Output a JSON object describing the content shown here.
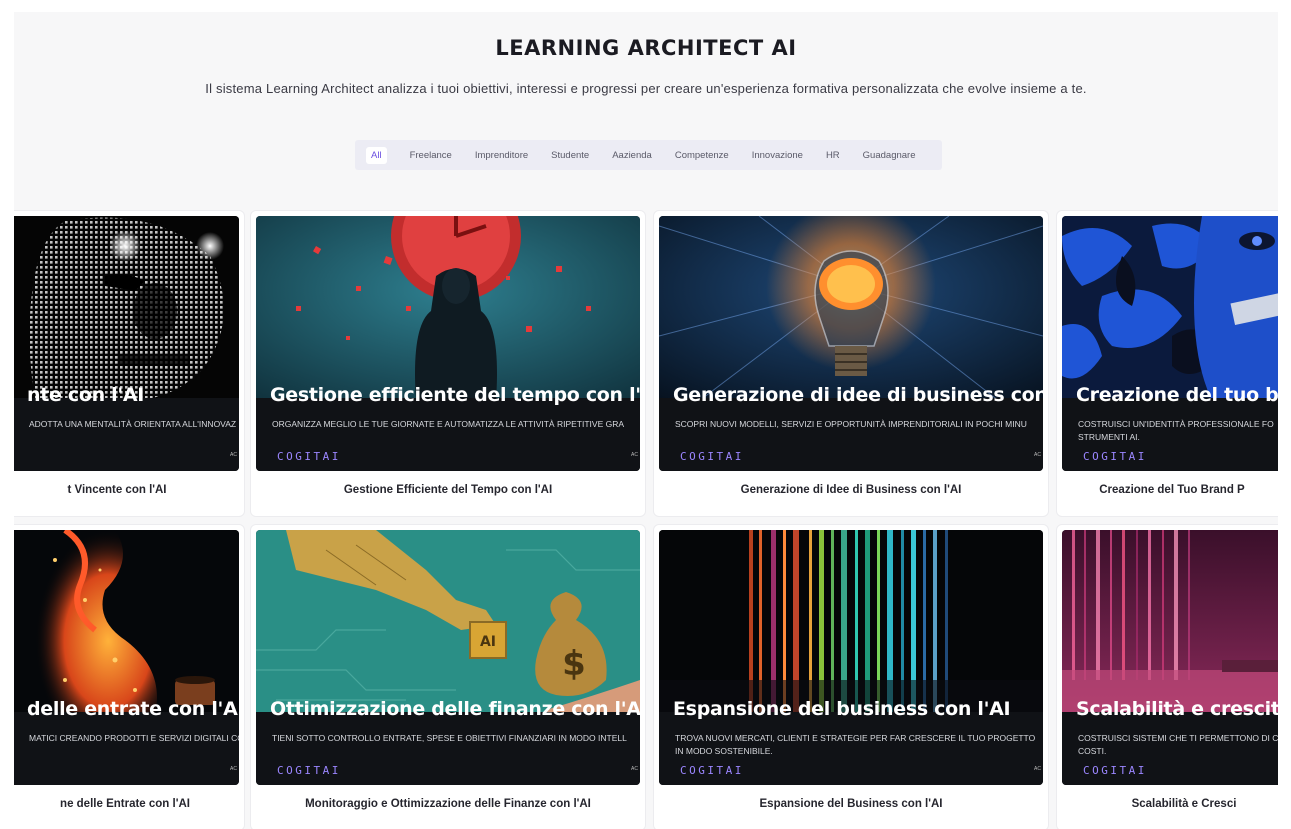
{
  "header": {
    "title": "LEARNING ARCHITECT AI",
    "subtitle": "Il sistema Learning Architect analizza i tuoi obiettivi, interessi e progressi per creare un'esperienza formativa personalizzata che evolve insieme a te."
  },
  "filters": {
    "active": "All",
    "items": [
      "All",
      "Freelance",
      "Imprenditore",
      "Studente",
      "Aazienda",
      "Competenze",
      "Innovazione",
      "HR",
      "Guadagnare"
    ]
  },
  "brand": {
    "logo_text": "COGITAI",
    "corner_text": "AC",
    "accent_color": "#9b86ff"
  },
  "cards": [
    {
      "headline": "nte con l'AI",
      "description": "ADOTTA UNA MENTALITÀ ORIENTATA ALL'INNOVAZ",
      "caption": "t Vincente con l'AI",
      "image": "digital-face"
    },
    {
      "headline": "Gestione efficiente del tempo con l'A",
      "description": "ORGANIZZA MEGLIO LE TUE GIORNATE E AUTOMATIZZA LE ATTIVITÀ RIPETITIVE GRA",
      "caption": "Gestione Efficiente del Tempo con l'AI",
      "image": "hooded-figure-clock"
    },
    {
      "headline": "Generazione di idee di business con l",
      "description": "SCOPRI NUOVI MODELLI, SERVIZI E OPPORTUNITÀ IMPRENDITORIALI IN POCHI MINU",
      "caption": "Generazione di Idee di Business con l'AI",
      "image": "brain-lightbulb"
    },
    {
      "headline": "Creazione del tuo br",
      "description": "COSTRUISCI UN'IDENTITÀ PROFESSIONALE FO STRUMENTI AI.",
      "caption": "Creazione del Tuo Brand P",
      "image": "blue-face"
    },
    {
      "headline": "delle entrate con l'AI",
      "description": "MATICI CREANDO PRODOTTI E SERVIZI DIGITALI CO",
      "caption": "ne delle Entrate con l'AI",
      "image": "fire-figure"
    },
    {
      "headline": "Ottimizzazione delle finanze con l'AI",
      "description": "TIENI SOTTO CONTROLLO ENTRATE, SPESE E OBIETTIVI FINANZIARI IN MODO INTELL",
      "caption": "Monitoraggio e Ottimizzazione delle Finanze con l'AI",
      "image": "robot-hand-money"
    },
    {
      "headline": "Espansione del business con l'AI",
      "description": "TROVA NUOVI MERCATI, CLIENTI E STRATEGIE PER FAR CRESCERE IL TUO PROGETTO IN MODO SOSTENIBILE.",
      "caption": "Espansione del Business con l'AI",
      "image": "light-stripes"
    },
    {
      "headline": "Scalabilità e crescita",
      "description": "COSTRUISCI SISTEMI CHE TI PERMETTONO DI C E COSTI.",
      "caption": "Scalabilità e Cresci",
      "image": "pink-stripes"
    }
  ]
}
